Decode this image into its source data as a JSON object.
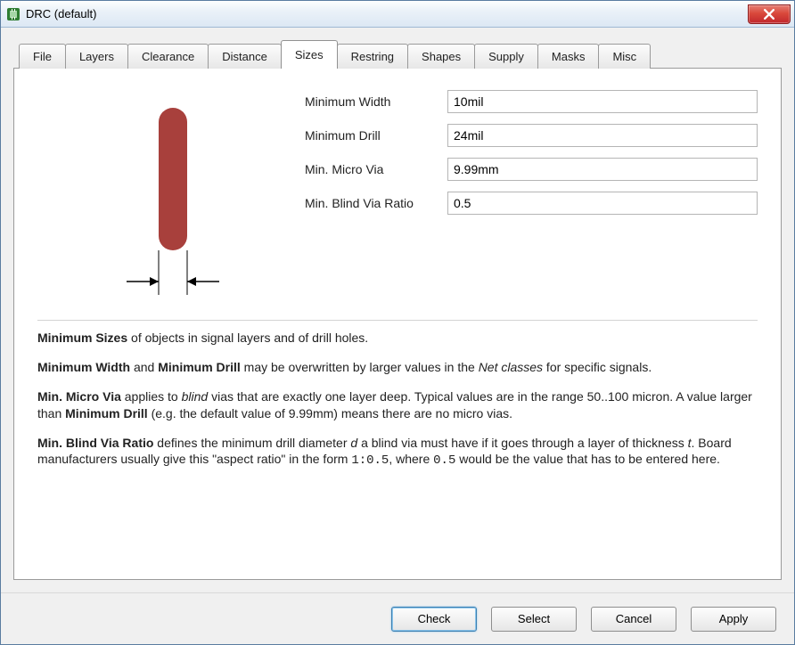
{
  "window": {
    "title": "DRC (default)"
  },
  "tabs": [
    {
      "label": "File"
    },
    {
      "label": "Layers"
    },
    {
      "label": "Clearance"
    },
    {
      "label": "Distance"
    },
    {
      "label": "Sizes"
    },
    {
      "label": "Restring"
    },
    {
      "label": "Shapes"
    },
    {
      "label": "Supply"
    },
    {
      "label": "Masks"
    },
    {
      "label": "Misc"
    }
  ],
  "active_tab": "Sizes",
  "fields": {
    "min_width": {
      "label": "Minimum Width",
      "value": "10mil"
    },
    "min_drill": {
      "label": "Minimum Drill",
      "value": "24mil"
    },
    "min_micro": {
      "label": "Min. Micro Via",
      "value": "9.99mm"
    },
    "min_blind": {
      "label": "Min. Blind Via Ratio",
      "value": "0.5"
    }
  },
  "description": {
    "p1_a": "Minimum Sizes",
    "p1_b": " of objects in signal layers and of drill holes.",
    "p2_a": "Minimum Width",
    "p2_b": " and ",
    "p2_c": "Minimum Drill",
    "p2_d": " may be overwritten by larger values in the ",
    "p2_e": "Net classes",
    "p2_f": " for specific signals.",
    "p3_a": "Min. Micro Via",
    "p3_b": " applies to ",
    "p3_c": "blind",
    "p3_d": " vias that are exactly one layer deep. Typical values are in the range 50..100 micron. A value larger than ",
    "p3_e": "Minimum Drill",
    "p3_f": " (e.g. the default value of 9.99mm) means there are no micro vias.",
    "p4_a": "Min. Blind Via Ratio",
    "p4_b": " defines the minimum drill diameter ",
    "p4_c": "d",
    "p4_d": " a blind via must have if it goes through a layer of thickness ",
    "p4_e": "t",
    "p4_f": ". Board manufacturers usually give this \"aspect ratio\" in the form ",
    "p4_g": "1:0.5",
    "p4_h": ", where ",
    "p4_i": "0.5",
    "p4_j": " would be the value that has to be entered here."
  },
  "buttons": {
    "check": "Check",
    "select": "Select",
    "cancel": "Cancel",
    "apply": "Apply"
  },
  "colors": {
    "trace": "#a8403c"
  }
}
